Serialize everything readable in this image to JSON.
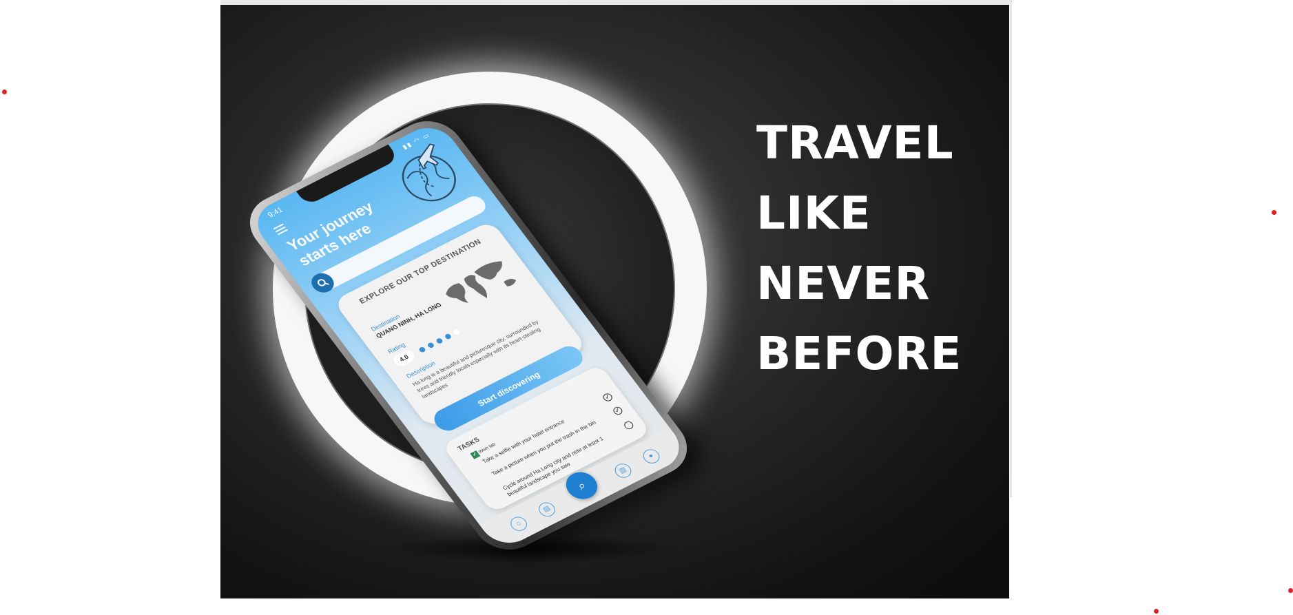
{
  "slogan": {
    "lines": [
      "TRAVEL",
      "LIKE",
      "NEVER",
      "BEFORE"
    ]
  },
  "phone": {
    "status_time": "9:41",
    "headline": "Your journey starts here",
    "explore_card": {
      "title": "EXPLORE OUR TOP DESTINATION",
      "destination_label": "Destination",
      "destination_value": "QUANG NINH, HA LONG",
      "rating_label": "Rating",
      "rating_value": "4.0",
      "rating_filled": 4,
      "rating_max": 5,
      "description_label": "Description",
      "description_text": "Ha long is a beautiful and picturesque city, surrounded by trees and friendly locals especially with its heart-stealing landscapes"
    },
    "cta_label": "Start discovering",
    "tasks": {
      "title": "TASKS",
      "tag": "town lab",
      "items": [
        {
          "text": "Take a selfie with your hotel entrance",
          "done": true
        },
        {
          "text": "Take a picture when you put the trash in the bin",
          "done": true
        },
        {
          "text": "Cycle around Ha Long city and note at least 1 beautiful landscape you saw",
          "done": false
        }
      ]
    }
  },
  "colors": {
    "accent": "#3a9be8",
    "dark_accent": "#1f7fd0",
    "marker": "#e02020"
  }
}
